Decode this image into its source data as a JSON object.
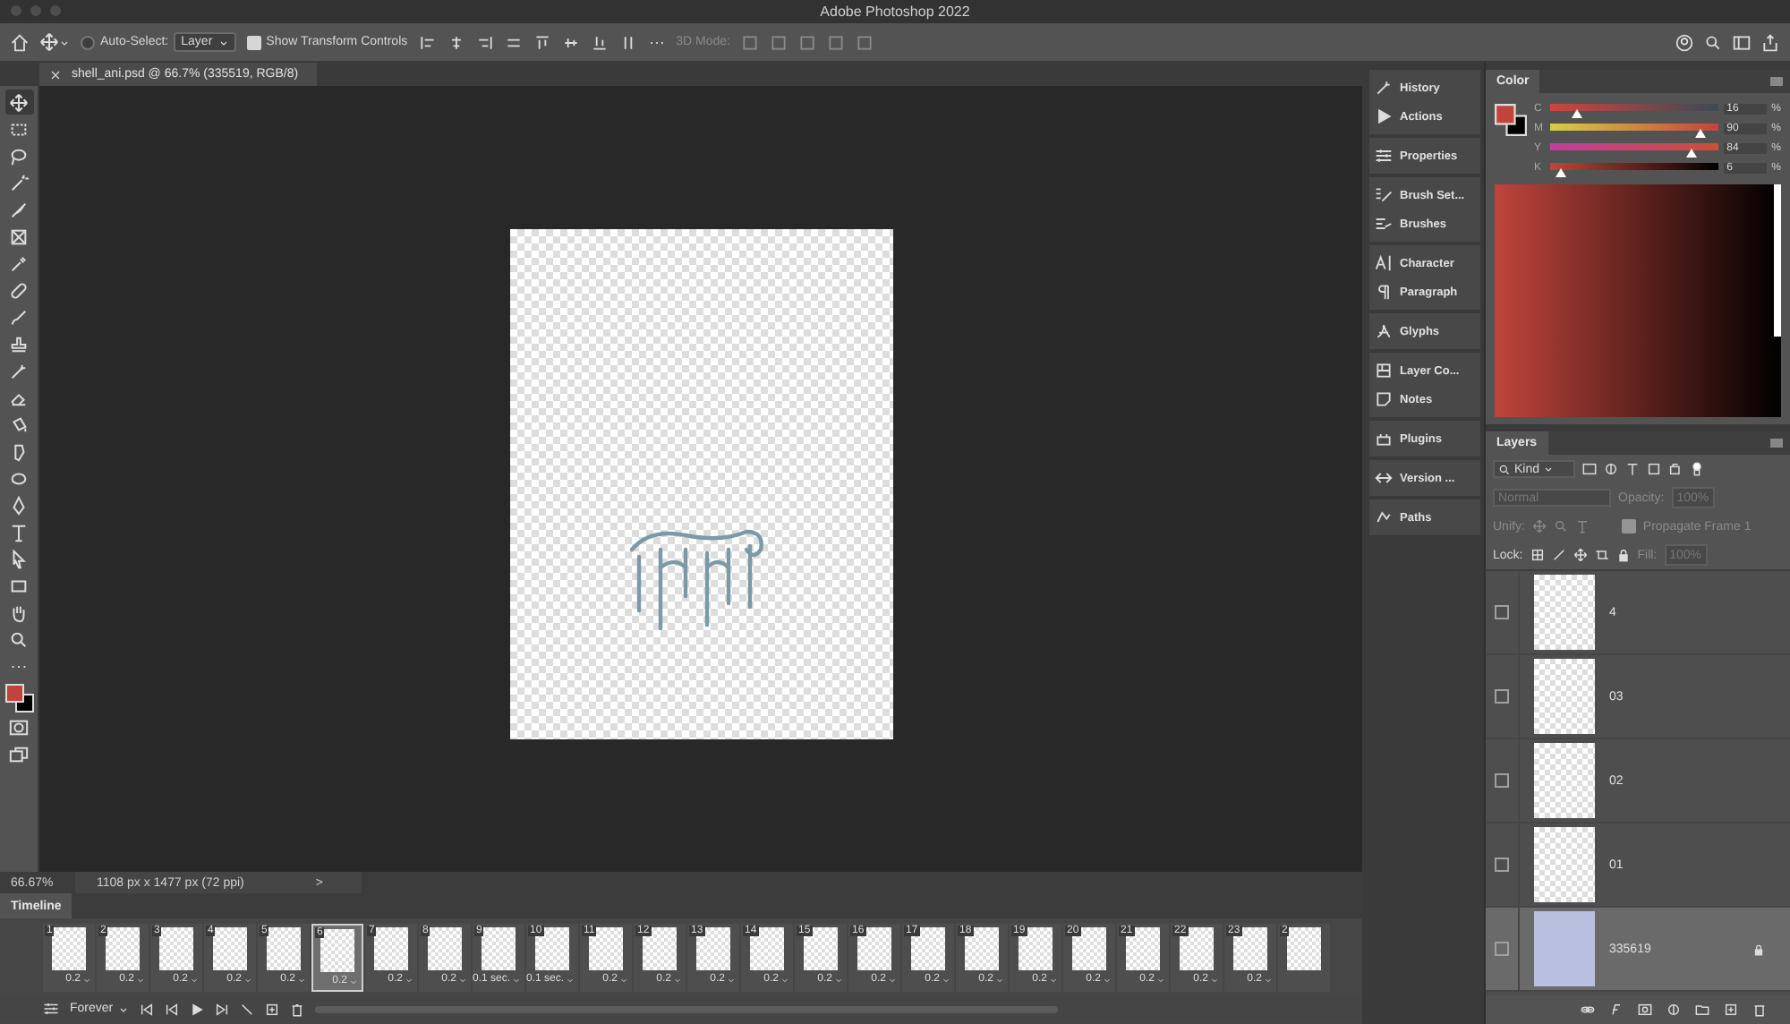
{
  "window": {
    "title": "Adobe Photoshop 2022"
  },
  "options_bar": {
    "auto_select": {
      "label": "Auto-Select:",
      "checked": false,
      "value": "Layer"
    },
    "show_transform": {
      "label": "Show Transform Controls",
      "checked": true
    },
    "mode_3d": "3D Mode:"
  },
  "document_tab": {
    "title": "shell_ani.psd @ 66.7% (335519, RGB/8)"
  },
  "tools": [
    {
      "kind": "move",
      "selected": true
    },
    {
      "kind": "marquee",
      "selected": false
    },
    {
      "kind": "lasso",
      "selected": false
    },
    {
      "kind": "wand",
      "selected": false
    },
    {
      "kind": "feather",
      "selected": false
    },
    {
      "kind": "frame",
      "selected": false
    },
    {
      "kind": "eyedropper",
      "selected": false
    },
    {
      "kind": "bandage",
      "selected": false
    },
    {
      "kind": "brush",
      "selected": false
    },
    {
      "kind": "stamp",
      "selected": false
    },
    {
      "kind": "history",
      "selected": false
    },
    {
      "kind": "eraser",
      "selected": false
    },
    {
      "kind": "bucket",
      "selected": false
    },
    {
      "kind": "drop",
      "selected": false
    },
    {
      "kind": "sponge",
      "selected": false
    },
    {
      "kind": "pen",
      "selected": false
    },
    {
      "kind": "type",
      "selected": false
    },
    {
      "kind": "pointer",
      "selected": false
    },
    {
      "kind": "rect",
      "selected": false
    },
    {
      "kind": "hand",
      "selected": false
    },
    {
      "kind": "zoom",
      "selected": false
    },
    {
      "kind": "more",
      "selected": false
    }
  ],
  "status_bar": {
    "zoom": "66.67%",
    "info": "1108 px x 1477 px (72 ppi)",
    "arrow": ">"
  },
  "timeline": {
    "title": "Timeline",
    "loop": "Forever",
    "frames": [
      {
        "number": "1",
        "delay": "0.2",
        "selected": false
      },
      {
        "number": "2",
        "delay": "0.2",
        "selected": false
      },
      {
        "number": "3",
        "delay": "0.2",
        "selected": false
      },
      {
        "number": "4",
        "delay": "0.2",
        "selected": false
      },
      {
        "number": "5",
        "delay": "0.2",
        "selected": false
      },
      {
        "number": "6",
        "delay": "0.2",
        "selected": true
      },
      {
        "number": "7",
        "delay": "0.2",
        "selected": false
      },
      {
        "number": "8",
        "delay": "0.2",
        "selected": false
      },
      {
        "number": "9",
        "delay": "0.1 sec.",
        "selected": false
      },
      {
        "number": "10",
        "delay": "0.1 sec.",
        "selected": false
      },
      {
        "number": "11",
        "delay": "0.2",
        "selected": false
      },
      {
        "number": "12",
        "delay": "0.2",
        "selected": false
      },
      {
        "number": "13",
        "delay": "0.2",
        "selected": false
      },
      {
        "number": "14",
        "delay": "0.2",
        "selected": false
      },
      {
        "number": "15",
        "delay": "0.2",
        "selected": false
      },
      {
        "number": "16",
        "delay": "0.2",
        "selected": false
      },
      {
        "number": "17",
        "delay": "0.2",
        "selected": false
      },
      {
        "number": "18",
        "delay": "0.2",
        "selected": false
      },
      {
        "number": "19",
        "delay": "0.2",
        "selected": false
      },
      {
        "number": "20",
        "delay": "0.2",
        "selected": false
      },
      {
        "number": "21",
        "delay": "0.2",
        "selected": false
      },
      {
        "number": "22",
        "delay": "0.2",
        "selected": false
      },
      {
        "number": "23",
        "delay": "0.2",
        "selected": false
      },
      {
        "number": "2",
        "selected": false
      }
    ]
  },
  "dock_groups": [
    {
      "items": [
        {
          "label": "History",
          "kind": "history"
        },
        {
          "label": "Actions",
          "kind": "play"
        }
      ]
    },
    {
      "items": [
        {
          "label": "Properties",
          "kind": "sliders"
        }
      ]
    },
    {
      "items": [
        {
          "label": "Brush Set...",
          "kind": "brushset"
        },
        {
          "label": "Brushes",
          "kind": "brushes"
        }
      ]
    },
    {
      "items": [
        {
          "label": "Character",
          "kind": "character"
        },
        {
          "label": "Paragraph",
          "kind": "pilcrow"
        }
      ]
    },
    {
      "items": [
        {
          "label": "Glyphs",
          "kind": "glyph"
        }
      ]
    },
    {
      "items": [
        {
          "label": "Layer Co...",
          "kind": "layercomp"
        },
        {
          "label": "Notes",
          "kind": "note"
        }
      ]
    },
    {
      "items": [
        {
          "label": "Plugins",
          "kind": "plugin"
        }
      ]
    },
    {
      "items": [
        {
          "label": "Version ...",
          "kind": "version"
        }
      ]
    },
    {
      "items": [
        {
          "label": "Paths",
          "kind": "paths"
        }
      ]
    }
  ],
  "color_panel": {
    "title": "Color",
    "channels": [
      {
        "label": "C",
        "reading": "16",
        "unit": "%",
        "level": 0.16
      },
      {
        "label": "M",
        "reading": "90",
        "unit": "%",
        "level": 0.9
      },
      {
        "label": "Y",
        "reading": "84",
        "unit": "%",
        "level": 0.84
      },
      {
        "label": "K",
        "reading": "6",
        "unit": "%",
        "level": 0.06
      }
    ]
  },
  "layers_panel": {
    "title": "Layers",
    "filter": "Kind",
    "blend_mode": "Normal",
    "opacity_label": "Opacity:",
    "opacity": "100%",
    "unify_label": "Unify:",
    "propagate": {
      "label": "Propagate Frame 1",
      "checked": true
    },
    "lock_label": "Lock:",
    "fill_label": "Fill:",
    "fill": "100%",
    "layers": [
      {
        "name": "4",
        "visible": false,
        "selected": false,
        "locked": false
      },
      {
        "name": "03",
        "visible": false,
        "selected": false,
        "locked": false
      },
      {
        "name": "02",
        "visible": false,
        "selected": false,
        "locked": false
      },
      {
        "name": "01",
        "visible": false,
        "selected": false,
        "locked": false
      },
      {
        "name": "335619",
        "visible": false,
        "selected": true,
        "locked": true
      }
    ]
  }
}
